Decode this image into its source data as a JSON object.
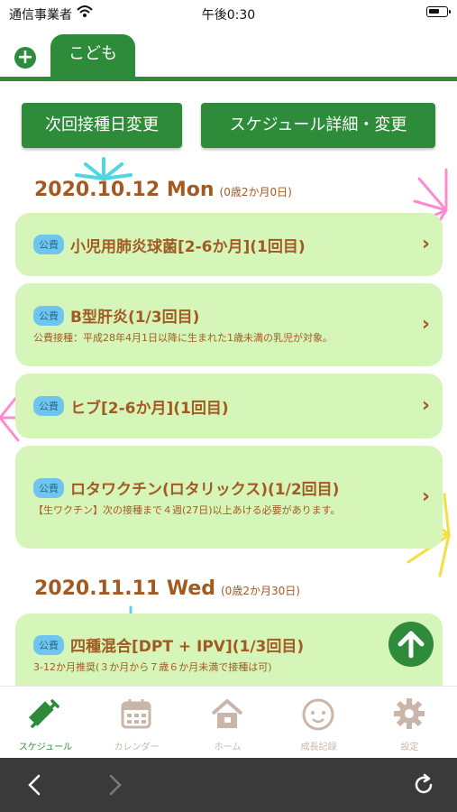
{
  "status_bar": {
    "carrier": "通信事業者",
    "time": "午後0:30"
  },
  "tabs": {
    "child_tab_label": "こども"
  },
  "buttons": {
    "next_date": "次回接種日変更",
    "schedule_detail": "スケジュール詳細・変更"
  },
  "schedule": [
    {
      "date": "2020.10.12 Mon",
      "age": "(0歳2か月0日)",
      "items": [
        {
          "badge": "公費",
          "title": "小児用肺炎球菌[2-6か月](1回目)",
          "note": ""
        },
        {
          "badge": "公費",
          "title": "B型肝炎(1/3回目)",
          "note": "公費接種：平成28年4月1日以降に生まれた1歳未満の乳児が対象。"
        },
        {
          "badge": "公費",
          "title": "ヒブ[2-6か月](1回目)",
          "note": ""
        },
        {
          "badge": "公費",
          "title": "ロタワクチン(ロタリックス)(1/2回目)",
          "note": "【生ワクチン】次の接種まで４週(27日)以上あける必要があります。"
        }
      ]
    },
    {
      "date": "2020.11.11 Wed",
      "age": "(0歳2か月30日)",
      "items": [
        {
          "badge": "公費",
          "title": "四種混合[DPT + IPV](1/3回目)",
          "note": "3-12か月推奨(３か月から７歳６か月未満で接種は可)"
        }
      ]
    }
  ],
  "tabbar": [
    {
      "label": "スケジュール",
      "icon": "syringe-icon",
      "active": true
    },
    {
      "label": "カレンダー",
      "icon": "calendar-icon",
      "active": false
    },
    {
      "label": "ホーム",
      "icon": "home-icon",
      "active": false
    },
    {
      "label": "成長記録",
      "icon": "baby-face-icon",
      "active": false
    },
    {
      "label": "設定",
      "icon": "gear-icon",
      "active": false
    }
  ],
  "colors": {
    "primary": "#2e8b3a",
    "card_bg": "#d6f5b8",
    "text_brown": "#a35a22",
    "badge_blue": "#6ec6f0",
    "inactive_tab": "#c9b6a8",
    "browser_bar": "#3a3a3a"
  }
}
